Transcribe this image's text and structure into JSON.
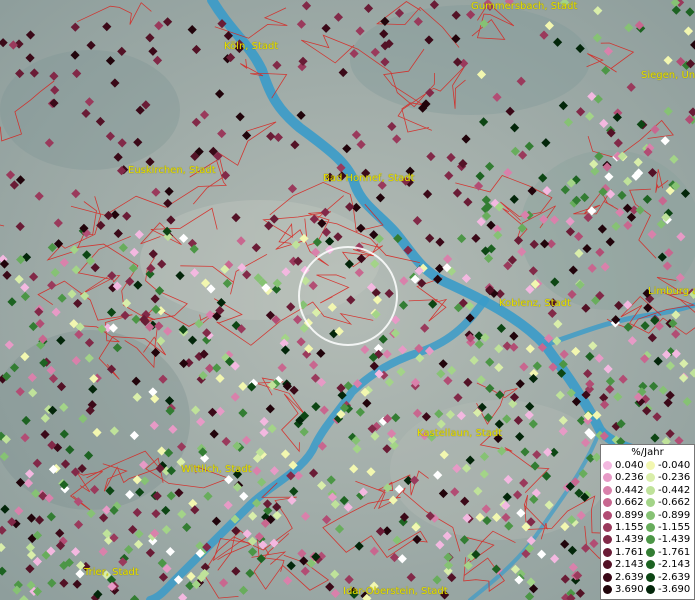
{
  "cities": [
    {
      "id": "gummersbach",
      "label": "Gummersbach, Stadt"
    },
    {
      "id": "koeln",
      "label": "Köln, Stadt"
    },
    {
      "id": "siegen",
      "label": "Siegen, Un"
    },
    {
      "id": "euskirchen",
      "label": "Euskirchen, Stadt"
    },
    {
      "id": "badhonnef",
      "label": "Bad Honnef, Stadt"
    },
    {
      "id": "koblenz",
      "label": "Koblenz, Stadt"
    },
    {
      "id": "limburg",
      "label": "Limburg a"
    },
    {
      "id": "kastellaun",
      "label": "Kastellaun, Stadt"
    },
    {
      "id": "wittlich",
      "label": "Wittlich, Stadt"
    },
    {
      "id": "trier",
      "label": "Trier, Stadt"
    },
    {
      "id": "idar",
      "label": "Idar-Oberstein, Stadt"
    }
  ],
  "legend": {
    "title": "%/Jahr",
    "positive": [
      {
        "label": "0.040",
        "color": "#f3b8e0"
      },
      {
        "label": "0.236",
        "color": "#e79ac6"
      },
      {
        "label": "0.442",
        "color": "#d981ab"
      },
      {
        "label": "0.662",
        "color": "#c8678f"
      },
      {
        "label": "0.899",
        "color": "#b24d74"
      },
      {
        "label": "1.155",
        "color": "#9a3a5c"
      },
      {
        "label": "1.439",
        "color": "#822948"
      },
      {
        "label": "1.761",
        "color": "#6a1c36"
      },
      {
        "label": "2.143",
        "color": "#531226"
      },
      {
        "label": "2.639",
        "color": "#3b0918"
      },
      {
        "label": "3.690",
        "color": "#21040b"
      }
    ],
    "negative": [
      {
        "label": "-0.040",
        "color": "#f2f7b0"
      },
      {
        "label": "-0.236",
        "color": "#d9eeaa"
      },
      {
        "label": "-0.442",
        "color": "#bfe29a"
      },
      {
        "label": "-0.662",
        "color": "#a3d488"
      },
      {
        "label": "-0.899",
        "color": "#86c274"
      },
      {
        "label": "-1.155",
        "color": "#68ad5c"
      },
      {
        "label": "-1.439",
        "color": "#4c9646"
      },
      {
        "label": "-1.761",
        "color": "#337d33"
      },
      {
        "label": "-2.143",
        "color": "#1d6322"
      },
      {
        "label": "-2.639",
        "color": "#0d4614"
      },
      {
        "label": "-3.690",
        "color": "#03260a"
      }
    ]
  },
  "colors": {
    "river": "#3a9bc9",
    "border": "#d9231e",
    "label": "#e8e000"
  }
}
